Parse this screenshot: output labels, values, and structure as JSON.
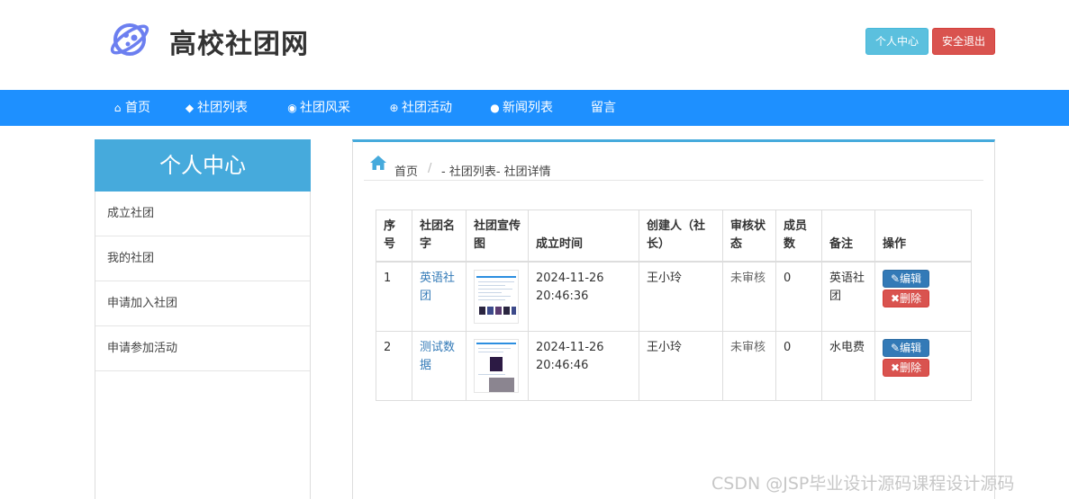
{
  "site": {
    "title": "高校社团网"
  },
  "header": {
    "user_center": "个人中心",
    "logout": "安全退出"
  },
  "nav": [
    {
      "label": "首页",
      "icon": "home-icon"
    },
    {
      "label": "社团列表",
      "icon": "cube-icon"
    },
    {
      "label": "社团风采",
      "icon": "record-icon"
    },
    {
      "label": "社团活动",
      "icon": "lifebuoy-icon"
    },
    {
      "label": "新闻列表",
      "icon": "globe-icon"
    },
    {
      "label": "留言",
      "icon": ""
    }
  ],
  "sidebar": {
    "title": "个人中心",
    "items": [
      "成立社团",
      "我的社团",
      "申请加入社团",
      "申请参加活动"
    ]
  },
  "breadcrumb": {
    "home": "首页",
    "sep": "/",
    "path": "- 社团列表- 社团详情"
  },
  "table": {
    "headers": [
      "序号",
      "社团名字",
      "社团宣传图",
      "成立时间",
      "创建人（社长）",
      "审核状态",
      "成员数",
      "备注",
      "操作"
    ],
    "rows": [
      {
        "no": "1",
        "name": "英语社团",
        "time": "2024-11-26 20:46:36",
        "creator": "王小玲",
        "status": "未审核",
        "members": "0",
        "remark": "英语社团",
        "edit": "编辑",
        "delete": "删除"
      },
      {
        "no": "2",
        "name": "测试数据",
        "time": "2024-11-26 20:46:46",
        "creator": "王小玲",
        "status": "未审核",
        "members": "0",
        "remark": "水电费",
        "edit": "编辑",
        "delete": "删除"
      }
    ]
  },
  "watermark": "CSDN @JSP毕业设计源码课程设计源码",
  "colors": {
    "nav": "#1e90ff",
    "sidebar_head": "#46aadc",
    "info": "#5bc0de",
    "danger": "#d9534f",
    "primary": "#337ab7"
  }
}
